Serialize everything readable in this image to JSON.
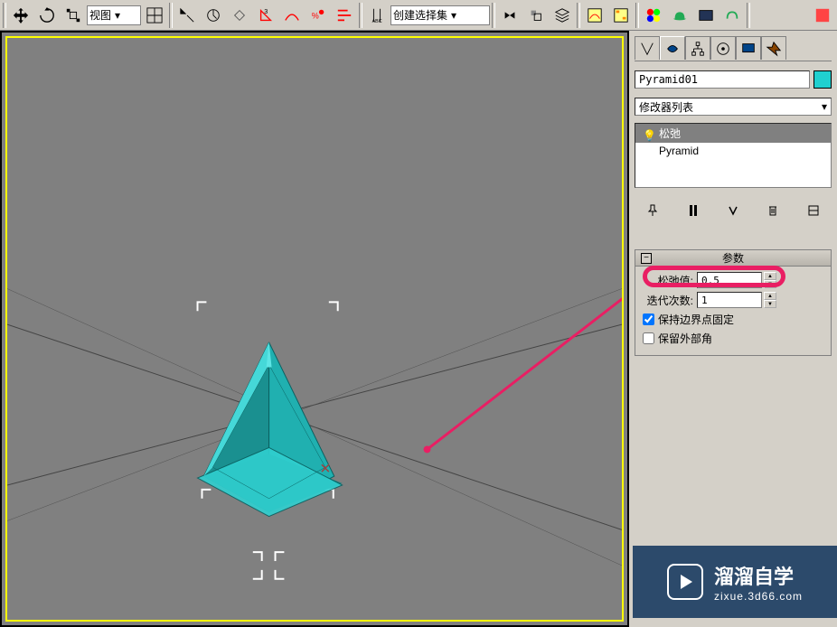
{
  "toolbar": {
    "view_dropdown": "视图",
    "create_set_dropdown": "创建选择集"
  },
  "panel": {
    "object_name": "Pyramid01",
    "modifier_dropdown": "修改器列表",
    "stack": {
      "mod1": "松弛",
      "mod2": "Pyramid"
    },
    "rollout_title": "参数",
    "params": {
      "relax_label": "松弛值:",
      "relax_value": "0.5",
      "iter_label": "迭代次数:",
      "iter_value": "1",
      "checkbox1": "保持边界点固定",
      "checkbox2": "保留外部角"
    }
  },
  "watermark": {
    "title": "溜溜自学",
    "url": "zixue.3d66.com"
  }
}
